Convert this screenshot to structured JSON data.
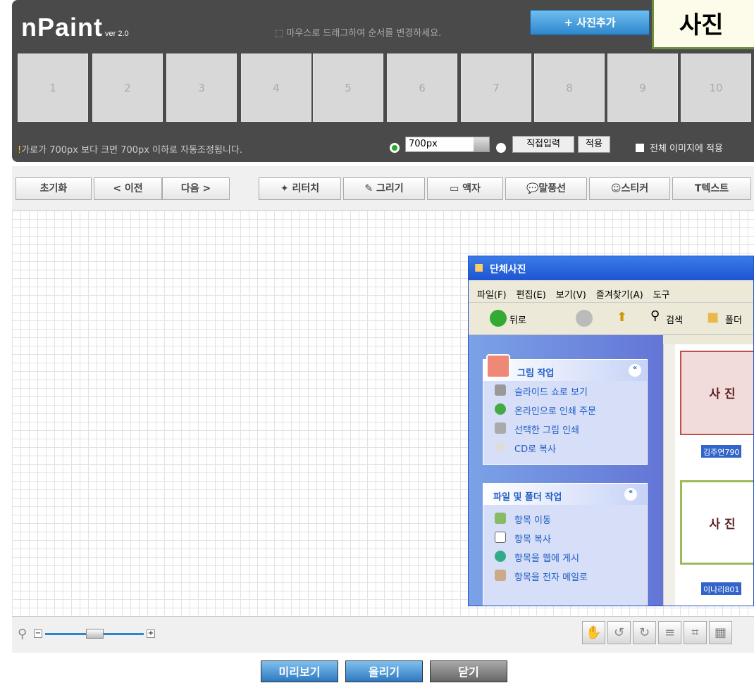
{
  "app": {
    "name": "nPaint",
    "version": "ver 2.0"
  },
  "header": {
    "drag_hint": "마우스로 드래그하여 순서를 변경하세요.",
    "add_photo_label": "+ 사진추가",
    "big_title": "사진"
  },
  "slots": [
    "1",
    "2",
    "3",
    "4",
    "5",
    "6",
    "7",
    "8",
    "9",
    "10"
  ],
  "resize": {
    "notice": "가로가 700px 보다 크면 700px 이하로 자동조정됩니다.",
    "size_value": "700px",
    "direct_input_label": "직접입력",
    "apply_label": "적용",
    "apply_all_label": "전체 이미지에 적용"
  },
  "toolbar": {
    "reset": "초기화",
    "prev": "< 이전",
    "next": "다음 >",
    "retouch": "리터치",
    "draw": "그리기",
    "frame": "액자",
    "bubble": "말풍선",
    "sticker": "스티커",
    "text": "텍스트"
  },
  "explorer": {
    "title": "단체사진",
    "menu": [
      "파일(F)",
      "편집(E)",
      "보기(V)",
      "즐겨찾기(A)",
      "도구"
    ],
    "nav": {
      "back": "뒤로",
      "search": "검색",
      "folder": "폴더"
    },
    "picture_tasks": {
      "title": "그림 작업",
      "items": [
        "슬라이드 쇼로 보기",
        "온라인으로 인쇄 주문",
        "선택한 그림 인쇄",
        "CD로 복사"
      ]
    },
    "file_tasks": {
      "title": "파일 및 폴더 작업",
      "items": [
        "항목 이동",
        "항목 복사",
        "항목을 웹에 게시",
        "항목을 전자 메일로"
      ]
    },
    "photos": [
      {
        "label": "사 진",
        "caption": "김주연790"
      },
      {
        "label": "사 진",
        "caption": "이나리801"
      }
    ]
  },
  "bottom": {
    "preview": "미리보기",
    "upload": "올리기",
    "close": "닫기"
  },
  "colors": {
    "topbar": "#4a4a4a",
    "accent": "#2d86cc",
    "frame_border": "#6d8e3a",
    "xp_blue": "#215dc6"
  }
}
